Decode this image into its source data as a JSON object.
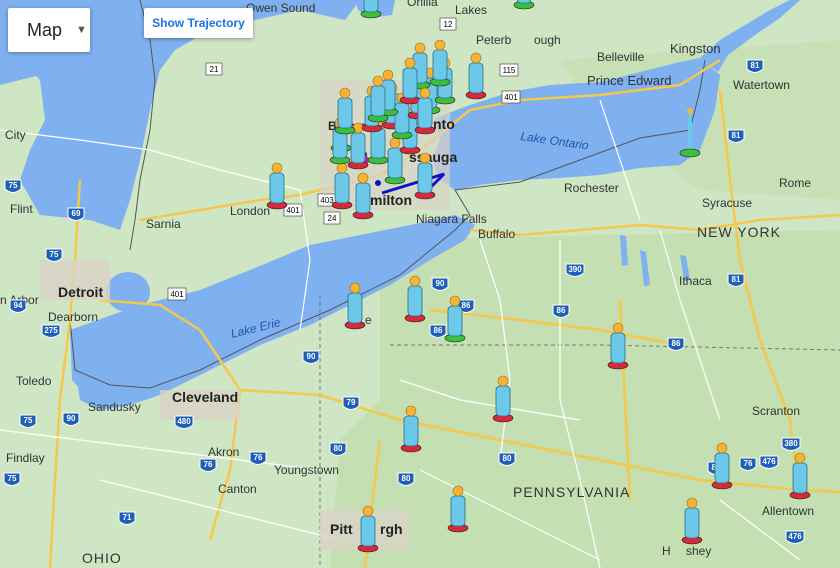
{
  "controls": {
    "map_type": "Map",
    "trajectory_button": "Show Trajectory"
  },
  "places": {
    "owen_sound": "Owen Sound",
    "orillia": "Orillia",
    "lakes": "Lakes",
    "peterborough_frag": "Peterb",
    "peterborough_frag2": "ough",
    "kingston": "Kingston",
    "belleville": "Belleville",
    "prince_edward": "Prince Edward",
    "watertown": "Watertown",
    "lake_ontario": "Lake Ontario",
    "brampton_frag": "Bramp",
    "toronto_frag": "nto",
    "mississauga_frag1": "M",
    "mississauga_frag2": "ssauga",
    "hamilton_frag": "milton",
    "city": "City",
    "london": "London",
    "sarnia": "Sarnia",
    "flint": "Flint",
    "rochester": "Rochester",
    "niagara_falls": "Niagara Falls",
    "buffalo": "Buffalo",
    "syracuse": "Syracuse",
    "rome": "Rome",
    "new_york": "NEW YORK",
    "ithaca": "Ithaca",
    "ann_arbor": "n Arbor",
    "detroit": "Detroit",
    "dearborn": "Dearborn",
    "lake_erie": "Lake Erie",
    "erie_frag": "e",
    "toledo": "Toledo",
    "sandusky": "Sandusky",
    "cleveland": "Cleveland",
    "akron": "Akron",
    "youngstown": "Youngstown",
    "canton": "Canton",
    "findlay": "Findlay",
    "scranton": "Scranton",
    "pennsylvania": "PENNSYLVANIA",
    "allentown": "Allentown",
    "hershey_frag": "H",
    "hershey_frag2": "shey",
    "pittsburgh_frag1": "Pitt",
    "pittsburgh_frag2": "rgh",
    "ohio": "OHIO"
  },
  "highway_shields": {
    "s12": "12",
    "s21": "21",
    "s115": "115",
    "s401a": "401",
    "s401b": "401",
    "s401c": "401",
    "s401d": "401",
    "s403": "403",
    "s24": "24",
    "s81a": "81",
    "s81b": "81",
    "s81c": "81",
    "s75a": "75",
    "s75b": "75",
    "s75c": "75",
    "s75d": "75",
    "s69": "69",
    "s275": "275",
    "s94": "94",
    "s90a": "90",
    "s90b": "90",
    "s90c": "90",
    "s390": "390",
    "s86a": "86",
    "s86b": "86",
    "s86c": "86",
    "s86d": "86",
    "s79": "79",
    "s480": "480",
    "s76a": "76",
    "s76b": "76",
    "s76c": "76",
    "s80a": "80",
    "s80b": "80",
    "s80c": "80",
    "s80d": "80",
    "s71": "71",
    "s380": "380",
    "s476a": "476",
    "s476b": "476"
  },
  "colors": {
    "land": "#cfe6c4",
    "water": "#7fb0f0",
    "road_major": "#f5c84a",
    "road_minor": "#ffffff",
    "figure_body": "#6cc8e8",
    "figure_head": "#f6b437",
    "base_red": "#d8283a",
    "base_green": "#3cc03c",
    "trajectory": "#1010d0",
    "magenta_dot": "#c020b0"
  },
  "markers": [
    {
      "shown_as": "person-figure",
      "base": "red"
    }
  ]
}
